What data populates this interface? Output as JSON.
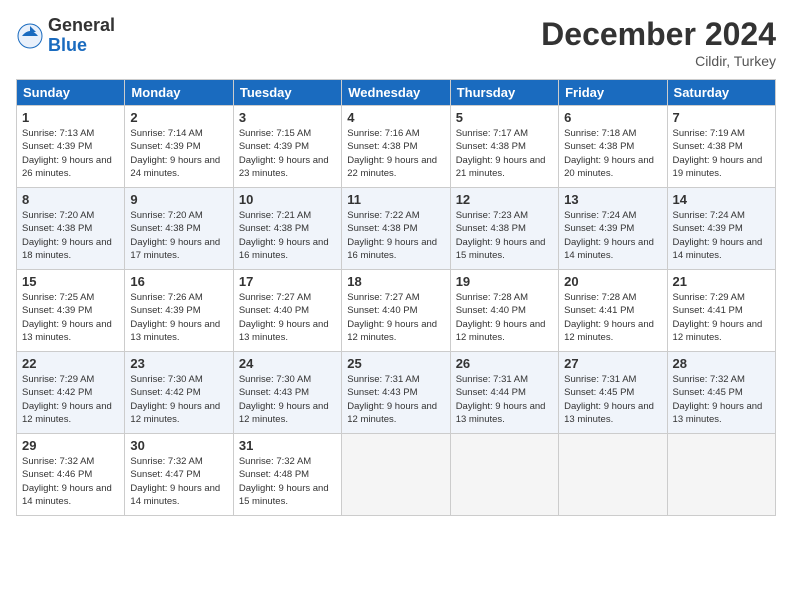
{
  "logo": {
    "general": "General",
    "blue": "Blue"
  },
  "title": "December 2024",
  "subtitle": "Cildir, Turkey",
  "days": [
    "Sunday",
    "Monday",
    "Tuesday",
    "Wednesday",
    "Thursday",
    "Friday",
    "Saturday"
  ],
  "weeks": [
    [
      {
        "day": "1",
        "sunrise": "7:13 AM",
        "sunset": "4:39 PM",
        "daylight": "9 hours and 26 minutes."
      },
      {
        "day": "2",
        "sunrise": "7:14 AM",
        "sunset": "4:39 PM",
        "daylight": "9 hours and 24 minutes."
      },
      {
        "day": "3",
        "sunrise": "7:15 AM",
        "sunset": "4:39 PM",
        "daylight": "9 hours and 23 minutes."
      },
      {
        "day": "4",
        "sunrise": "7:16 AM",
        "sunset": "4:38 PM",
        "daylight": "9 hours and 22 minutes."
      },
      {
        "day": "5",
        "sunrise": "7:17 AM",
        "sunset": "4:38 PM",
        "daylight": "9 hours and 21 minutes."
      },
      {
        "day": "6",
        "sunrise": "7:18 AM",
        "sunset": "4:38 PM",
        "daylight": "9 hours and 20 minutes."
      },
      {
        "day": "7",
        "sunrise": "7:19 AM",
        "sunset": "4:38 PM",
        "daylight": "9 hours and 19 minutes."
      }
    ],
    [
      {
        "day": "8",
        "sunrise": "7:20 AM",
        "sunset": "4:38 PM",
        "daylight": "9 hours and 18 minutes."
      },
      {
        "day": "9",
        "sunrise": "7:20 AM",
        "sunset": "4:38 PM",
        "daylight": "9 hours and 17 minutes."
      },
      {
        "day": "10",
        "sunrise": "7:21 AM",
        "sunset": "4:38 PM",
        "daylight": "9 hours and 16 minutes."
      },
      {
        "day": "11",
        "sunrise": "7:22 AM",
        "sunset": "4:38 PM",
        "daylight": "9 hours and 16 minutes."
      },
      {
        "day": "12",
        "sunrise": "7:23 AM",
        "sunset": "4:38 PM",
        "daylight": "9 hours and 15 minutes."
      },
      {
        "day": "13",
        "sunrise": "7:24 AM",
        "sunset": "4:39 PM",
        "daylight": "9 hours and 14 minutes."
      },
      {
        "day": "14",
        "sunrise": "7:24 AM",
        "sunset": "4:39 PM",
        "daylight": "9 hours and 14 minutes."
      }
    ],
    [
      {
        "day": "15",
        "sunrise": "7:25 AM",
        "sunset": "4:39 PM",
        "daylight": "9 hours and 13 minutes."
      },
      {
        "day": "16",
        "sunrise": "7:26 AM",
        "sunset": "4:39 PM",
        "daylight": "9 hours and 13 minutes."
      },
      {
        "day": "17",
        "sunrise": "7:27 AM",
        "sunset": "4:40 PM",
        "daylight": "9 hours and 13 minutes."
      },
      {
        "day": "18",
        "sunrise": "7:27 AM",
        "sunset": "4:40 PM",
        "daylight": "9 hours and 12 minutes."
      },
      {
        "day": "19",
        "sunrise": "7:28 AM",
        "sunset": "4:40 PM",
        "daylight": "9 hours and 12 minutes."
      },
      {
        "day": "20",
        "sunrise": "7:28 AM",
        "sunset": "4:41 PM",
        "daylight": "9 hours and 12 minutes."
      },
      {
        "day": "21",
        "sunrise": "7:29 AM",
        "sunset": "4:41 PM",
        "daylight": "9 hours and 12 minutes."
      }
    ],
    [
      {
        "day": "22",
        "sunrise": "7:29 AM",
        "sunset": "4:42 PM",
        "daylight": "9 hours and 12 minutes."
      },
      {
        "day": "23",
        "sunrise": "7:30 AM",
        "sunset": "4:42 PM",
        "daylight": "9 hours and 12 minutes."
      },
      {
        "day": "24",
        "sunrise": "7:30 AM",
        "sunset": "4:43 PM",
        "daylight": "9 hours and 12 minutes."
      },
      {
        "day": "25",
        "sunrise": "7:31 AM",
        "sunset": "4:43 PM",
        "daylight": "9 hours and 12 minutes."
      },
      {
        "day": "26",
        "sunrise": "7:31 AM",
        "sunset": "4:44 PM",
        "daylight": "9 hours and 13 minutes."
      },
      {
        "day": "27",
        "sunrise": "7:31 AM",
        "sunset": "4:45 PM",
        "daylight": "9 hours and 13 minutes."
      },
      {
        "day": "28",
        "sunrise": "7:32 AM",
        "sunset": "4:45 PM",
        "daylight": "9 hours and 13 minutes."
      }
    ],
    [
      {
        "day": "29",
        "sunrise": "7:32 AM",
        "sunset": "4:46 PM",
        "daylight": "9 hours and 14 minutes."
      },
      {
        "day": "30",
        "sunrise": "7:32 AM",
        "sunset": "4:47 PM",
        "daylight": "9 hours and 14 minutes."
      },
      {
        "day": "31",
        "sunrise": "7:32 AM",
        "sunset": "4:48 PM",
        "daylight": "9 hours and 15 minutes."
      },
      null,
      null,
      null,
      null
    ]
  ]
}
